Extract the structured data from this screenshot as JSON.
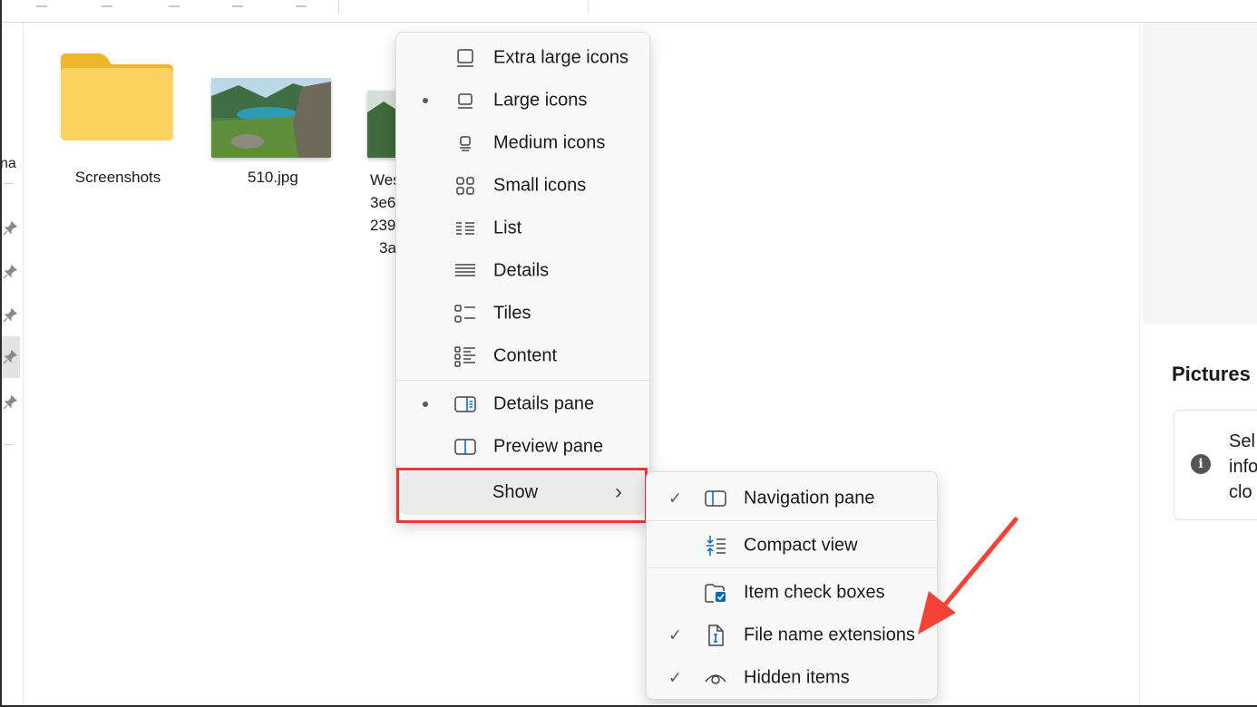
{
  "nav": {
    "fragment": "na"
  },
  "files": [
    {
      "name": "Screenshots",
      "kind": "folder"
    },
    {
      "name": "510.jpg",
      "kind": "image"
    },
    {
      "name_lines": [
        "Wes",
        "3e6",
        "239",
        "3a"
      ],
      "kind": "image"
    }
  ],
  "view_menu": {
    "items": [
      {
        "label": "Extra large icons",
        "icon": "extra-large-icons-icon",
        "selected": false
      },
      {
        "label": "Large icons",
        "icon": "large-icons-icon",
        "selected": true
      },
      {
        "label": "Medium icons",
        "icon": "medium-icons-icon",
        "selected": false
      },
      {
        "label": "Small icons",
        "icon": "small-icons-icon",
        "selected": false
      },
      {
        "label": "List",
        "icon": "list-icon",
        "selected": false
      },
      {
        "label": "Details",
        "icon": "details-icon",
        "selected": false
      },
      {
        "label": "Tiles",
        "icon": "tiles-icon",
        "selected": false
      },
      {
        "label": "Content",
        "icon": "content-icon",
        "selected": false
      }
    ],
    "pane_items": [
      {
        "label": "Details pane",
        "icon": "details-pane-icon",
        "selected": true
      },
      {
        "label": "Preview pane",
        "icon": "preview-pane-icon",
        "selected": false
      }
    ],
    "show_label": "Show",
    "show_chevron": "›"
  },
  "show_submenu": {
    "items": [
      {
        "label": "Navigation pane",
        "icon": "navigation-pane-icon",
        "checked": true
      },
      {
        "label": "Compact view",
        "icon": "compact-view-icon",
        "checked": false
      },
      {
        "label": "Item check boxes",
        "icon": "item-check-boxes-icon",
        "checked": false
      },
      {
        "label": "File name extensions",
        "icon": "file-name-extensions-icon",
        "checked": true
      },
      {
        "label": "Hidden items",
        "icon": "hidden-items-icon",
        "checked": true
      }
    ],
    "check_glyph": "✓"
  },
  "right_pane": {
    "title": "Pictures",
    "info_icon_glyph": "i",
    "info_lines": [
      "Sel",
      "info",
      "clo"
    ]
  },
  "colors": {
    "highlight": "#e53935",
    "arrow": "#f44336",
    "accent": "#0067c0"
  }
}
